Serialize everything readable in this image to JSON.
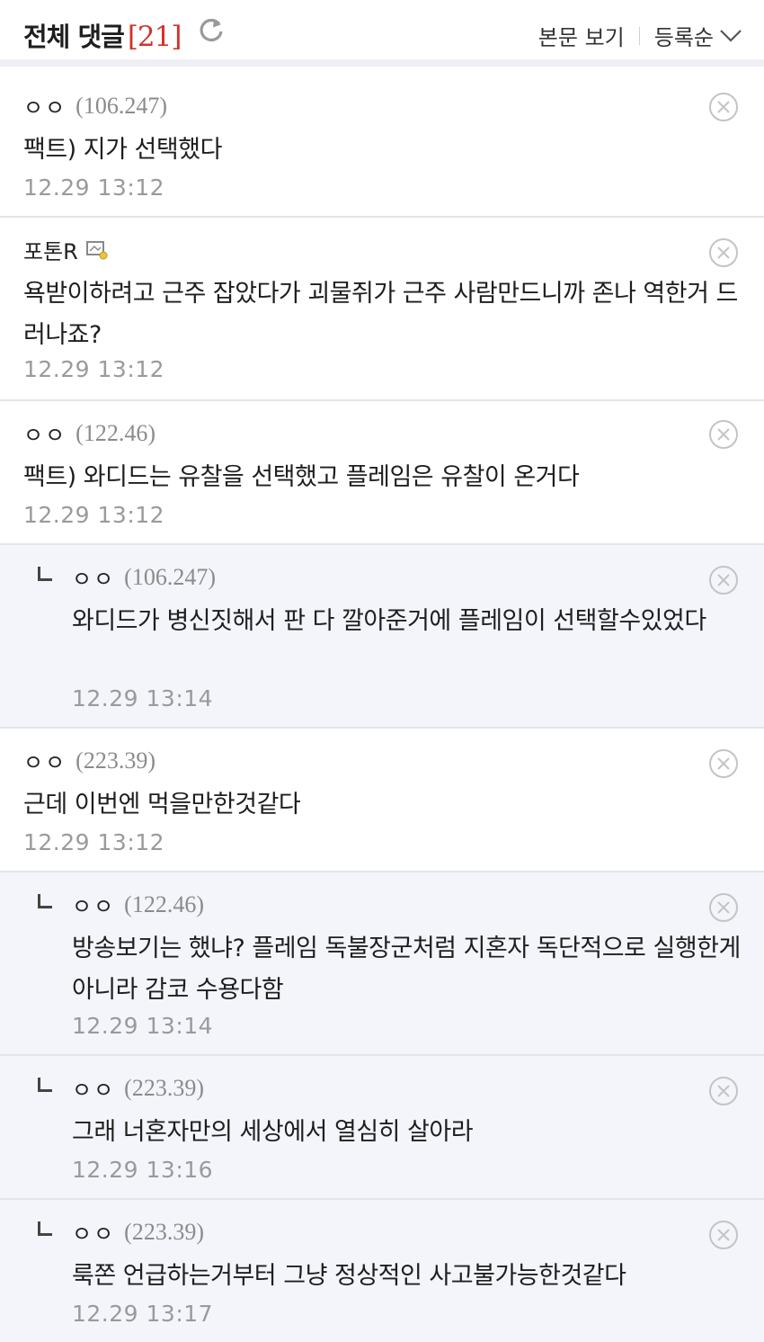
{
  "header": {
    "title": "전체 댓글",
    "count": "[21]",
    "view_body": "본문 보기",
    "sort": "등록순"
  },
  "comments": [
    {
      "nick": "ㅇㅇ",
      "ip": "(106.247)",
      "text": "팩트) 지가 선택했다",
      "date": "12.29 13:12",
      "reply": false
    },
    {
      "nick": "포톤R",
      "ip": "",
      "text": "욕받이하려고 근주 잡았다가 괴물쥐가 근주 사람만드니까 존나 역한거 드러나죠?",
      "date": "12.29 13:12",
      "reply": false
    },
    {
      "nick": "ㅇㅇ",
      "ip": "(122.46)",
      "text": "팩트) 와디드는 유찰을 선택했고 플레임은 유찰이 온거다",
      "date": "12.29 13:12",
      "reply": false
    },
    {
      "nick": "ㅇㅇ",
      "ip": "(106.247)",
      "text": "와디드가 병신짓해서 판 다 깔아준거에 플레임이 선택할수있었다",
      "date": "12.29 13:14",
      "reply": true
    },
    {
      "nick": "ㅇㅇ",
      "ip": "(223.39)",
      "text": "근데 이번엔 먹을만한것같다",
      "date": "12.29 13:12",
      "reply": false
    },
    {
      "nick": "ㅇㅇ",
      "ip": "(122.46)",
      "text": "방송보기는 했냐? 플레임 독불장군처럼 지혼자 독단적으로 실행한게아니라 감코 수용다함",
      "date": "12.29 13:14",
      "reply": true
    },
    {
      "nick": "ㅇㅇ",
      "ip": "(223.39)",
      "text": "그래 너혼자만의 세상에서 열심히 살아라",
      "date": "12.29 13:16",
      "reply": true
    },
    {
      "nick": "ㅇㅇ",
      "ip": "(223.39)",
      "text": "룩쫀 언급하는거부터 그냥 정상적인 사고불가능한것같다",
      "date": "12.29 13:17",
      "reply": true
    }
  ]
}
